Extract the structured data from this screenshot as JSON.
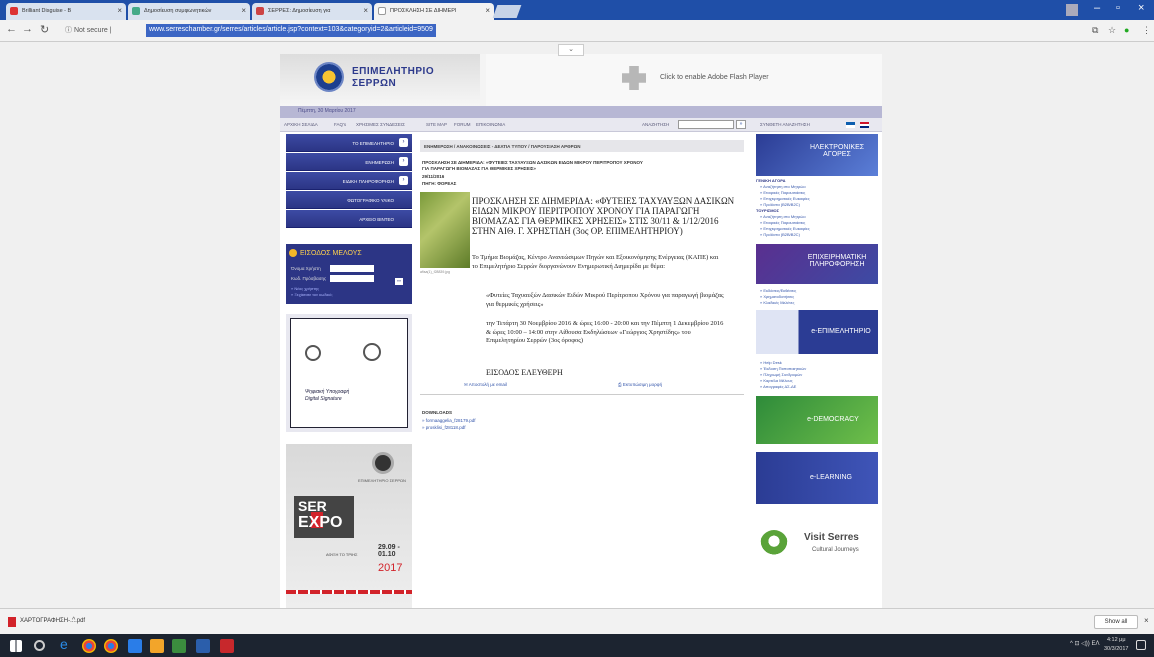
{
  "browser": {
    "tabs": [
      {
        "label": "Brilliant Disguise - B"
      },
      {
        "label": "Δημοσίευση συμφωνητικών"
      },
      {
        "label": "ΣΕΡΡΕΣ: Δημοσίευση για"
      },
      {
        "label": "ΠΡΟΣΚΛΗΣΗ ΣΕ ΔΙΗΜΕΡΙ"
      }
    ],
    "security": "Not secure",
    "url": "www.serreschamber.gr/serres/articles/article.jsp?context=103&categoryid=2&articleid=9509"
  },
  "site": {
    "name_line1": "ΕΠΙΜΕΛΗΤΗΡΙΟ",
    "name_line2": "ΣΕΡΡΩΝ",
    "flash_text": "Click to enable Adobe Flash Player",
    "date": "Πέμπτη, 30 Μαρτίου 2017",
    "menu": [
      "ΑΡΧΙΚΗ ΣΕΛΙΔΑ",
      "FAQ's",
      "ΧΡΗΣΙΜΕΣ ΣΥΝΔΕΣΕΙΣ",
      "SITE MAP",
      "FORUM",
      "ΕΠΙΚΟΙΝΩΝΙΑ"
    ],
    "search_label": "ΑΝΑΖΗΤΗΣΗ",
    "search_go": "»",
    "advanced_search": "ΣΥΝΘΕΤΗ ΑΝΑΖΗΤΗΣΗ"
  },
  "left": {
    "nav": [
      "ΤΟ ΕΠΙΜΕΛΗΤΗΡΙΟ",
      "ΕΝΗΜΕΡΩΣΗ",
      "ΕΙΔΙΚΗ ΠΛΗΡΟΦΟΡΗΣΗ",
      "ΦΩΤΟΓΡΑΦΙΚΟ ΥΛΙΚΟ",
      "ΑΡΧΕΙΟ ΒΙΝΤΕΟ"
    ],
    "login": {
      "title": "ΕΙΣΟΔΟΣ ΜΕΛΟΥΣ",
      "user_label": "Όνομα Χρήστη",
      "pass_label": "Κωδ. Πρόσβασης",
      "go": "»»",
      "link1": "» Νέος χρήστης",
      "link2": "» Ξεχάσατε τον κωδικό;"
    },
    "ad1_text1": "Ψηφιακή Υπογραφή",
    "ad1_text2": "Digital Signature",
    "ad2": {
      "org": "ΕΠΙΜΕΛΗΤΗΡΙΟ ΣΕΡΡΩΝ",
      "ser": "SER",
      "expo": "EXPO",
      "dates": "29.09 - 01.10",
      "year": "2017",
      "info": "ΑΦΙΞΗ ΤΟ ΤΡΙΗΣ"
    }
  },
  "main": {
    "breadcrumb": "ΕΝΗΜΕΡΩΣΗ / ΑΝΑΚΟΙΝΩΣΕΙΣ - ΔΕΛΤΙΑ ΤΥΠΟΥ / ΠΑΡΟΥΣΙΑΣΗ ΑΡΘΡΩΝ",
    "head1": "ΠΡΟΣΚΛΗΣΗ ΣΕ ΔΙΗΜΕΡΙΔΑ: «ΦΥΤΕΙΕΣ ΤΑΧΥΑΥΞΩΝ ΔΑΣΙΚΩΝ ΕΙΔΩΝ ΜΙΚΡΟΥ ΠΕΡΙΤΡΟΠΟΥ ΧΡΟΝΟΥ",
    "head2": "ΓΙΑ ΠΑΡΑΓΩΓΗ ΒΙΟΜΑΖΑΣ ΓΙΑ ΘΕΡΜΙΚΕΣ ΧΡΗΣΕΙΣ»",
    "date": "29/11/2016",
    "source": "ΠΗΓΗ: ΦΟΡΕΑΣ",
    "img_caption": "afisa(1)_f28839.jpg",
    "title": "ΠΡΟΣΚΛΗΣΗ ΣΕ ΔΙΗΜΕΡΙΔΑ: «ΦΥΤΕΙΕΣ ΤΑΧΥΑΥΞΩΝ ΔΑΣΙΚΩΝ ΕΙΔΩΝ ΜΙΚΡΟΥ ΠΕΡΙΤΡΟΠΟΥ ΧΡΟΝΟΥ ΓΙΑ ΠΑΡΑΓΩΓΗ ΒΙΟΜΑΖΑΣ ΓΙΑ ΘΕΡΜΙΚΕΣ ΧΡΗΣΕΙΣ» ΣΤΙΣ 30/11 & 1/12/2016 ΣΤΗΝ ΑΙΘ. Γ. ΧΡΗΣΤΙΔΗ (3ος ΟΡ. ΕΠΙΜΕΛΗΤΗΡΙΟΥ)",
    "p1": "Το Τμήμα Βιομάζας, Κέντρο Ανανεώσιμων Πηγών και Εξοικονόμησης Ενέργειας (ΚΑΠΕ) και το Επιμελητήριο Σερρών διοργανώνουν Ενημερωτική Διημερίδα με θέμα:",
    "p2": "«Φυτείες Ταχυαυξών Δασικών Ειδών Μικρού Περίτροπου Χρόνου για παραγωγή βιομάζας για θερμικές χρήσεις»",
    "p3": "την Τετάρτη 30 Νοεμβρίου 2016 & ώρες 16:00 - 20:00 και την Πέμπτη 1 Δεκεμβρίου 2016 & ώρες 10:00 – 14:00 στην Αίθουσα Εκδηλώσεων «Γεώργιος Χρηστίδης» του Επιμελητηρίου Σερρών (3ος όροφος)",
    "p4": "ΕΙΣΟΔΟΣ ΕΛΕΥΘΕΡΗ",
    "send_mail": "Αποστολή με email",
    "print": "Εκτυπώσιμη μορφή",
    "downloads_title": "DOWNLOADS",
    "downloads": [
      "» formaaggelia_f28179.pdf",
      "» prosklisi_f28118.pdf"
    ]
  },
  "right": {
    "box1": "ΗΛΕΚΤΡΟΝΙΚΕΣ ΑΓΟΡΕΣ",
    "hdr1": "ΓΕΝΙΚΗ ΑΓΟΡΑ",
    "links1": [
      "» Αναζήτηση στο Μητρώο",
      "» Εταιρικές Παρουσιάσεις",
      "» Επιχειρηματικές Ευκαιρίες",
      "» Προϊόντα (B2B/B2C)"
    ],
    "hdr2": "ΤΟΥΡΙΣΜΟΣ",
    "links2": [
      "» Αναζήτηση στο Μητρώο",
      "» Εταιρικές Παρουσιάσεις",
      "» Επιχειρηματικές Ευκαιρίες",
      "» Προϊόντα (B2B/B2C)"
    ],
    "box2": "ΕΠΙΧΕΙΡΗΜΑΤΙΚΗ ΠΛΗΡΟΦΟΡΗΣΗ",
    "links3": [
      "» Εκδόσεις/Εκθέσεις",
      "» Χρηματοδοτήσεις",
      "» Κλαδικές Μελέτες"
    ],
    "box3": "e-ΕΠΙΜΕΛΗΤΗΡΙΟ",
    "links4": [
      "» Help Desk",
      "» Έκδοση Πιστοποιητικών",
      "» Πληρωμή Συνδρομών",
      "» Καρτέλα Μέλους",
      "» Απογραφές ΔΣ-ΔΕ"
    ],
    "box4": "e-DEMOCRACY",
    "box5": "e-LEARNING",
    "visit_title": "Visit Serres",
    "visit_sub": "Cultural Journeys"
  },
  "downloads_bar": {
    "file": "ΧΑΡΤΟΓΡΑΦΗΣΗ-....pdf",
    "chevron": "^",
    "show_all": "Show all",
    "close": "×"
  },
  "taskbar": {
    "tray": "^ ⊡ ◁)) ΕΛ",
    "time": "4:12 μμ",
    "date": "30/3/2017"
  },
  "colors": {
    "accent": "#2c3585",
    "tab_strip": "#1f4fa8",
    "url_highlight": "#3c66c4"
  }
}
